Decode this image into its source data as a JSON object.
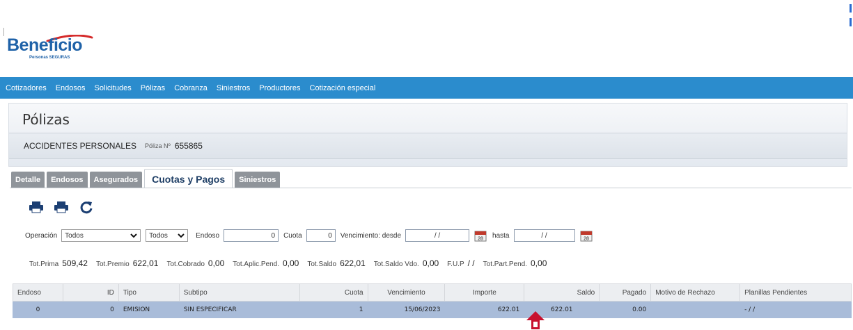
{
  "logo": {
    "name": "Beneficio",
    "tagline": "Personas SEGURAS"
  },
  "nav": [
    "Cotizadores",
    "Endosos",
    "Solicitudes",
    "Pólizas",
    "Cobranza",
    "Siniestros",
    "Productores",
    "Cotización especial"
  ],
  "page": {
    "title": "Pólizas",
    "policy_type": "ACCIDENTES PERSONALES",
    "policy_label": "Póliza Nº",
    "policy_number": "655865"
  },
  "tabs": [
    {
      "label": "Detalle",
      "active": false
    },
    {
      "label": "Endosos",
      "active": false
    },
    {
      "label": "Asegurados",
      "active": false
    },
    {
      "label": "Cuotas y Pagos",
      "active": true
    },
    {
      "label": "Siniestros",
      "active": false
    }
  ],
  "toolbar": {
    "icons": [
      "printer-icon",
      "printer-icon",
      "refresh-icon"
    ]
  },
  "filters": {
    "operacion_label": "Operación",
    "operacion_value": "Todos",
    "second_select_value": "Todos",
    "endoso_label": "Endoso",
    "endoso_value": "0",
    "cuota_label": "Cuota",
    "cuota_value": "0",
    "venc_desde_label": "Vencimiento: desde",
    "venc_desde_value": "/ /",
    "calendar_day": "28",
    "hasta_label": "hasta",
    "hasta_value": "/ /"
  },
  "totals": [
    {
      "label": "Tot.Prima",
      "value": "509,42"
    },
    {
      "label": "Tot.Premio",
      "value": "622,01"
    },
    {
      "label": "Tot.Cobrado",
      "value": "0,00"
    },
    {
      "label": "Tot.Aplic.Pend.",
      "value": "0,00"
    },
    {
      "label": "Tot.Saldo",
      "value": "622,01"
    },
    {
      "label": "Tot.Saldo Vdo.",
      "value": "0,00"
    },
    {
      "label": "F.U.P",
      "value": "/ /"
    },
    {
      "label": "Tot.Part.Pend.",
      "value": "0,00"
    }
  ],
  "table": {
    "columns": [
      "Endoso",
      "ID",
      "Tipo",
      "Subtipo",
      "Cuota",
      "Vencimiento",
      "Importe",
      "Saldo",
      "Pagado",
      "Motivo de Rechazo",
      "Planillas Pendientes"
    ],
    "rows": [
      [
        "0",
        "0",
        "EMISION",
        "SIN ESPECIFICAR",
        "1",
        "15/06/2023",
        "622.01",
        "622.01",
        "0.00",
        "",
        "- / /"
      ]
    ]
  },
  "colors": {
    "nav": "#2b8ccd",
    "row_selected": "#a9bcd9",
    "arrow": "#c8102e",
    "brand": "#1f62a8",
    "swoosh": "#d52b2b"
  }
}
